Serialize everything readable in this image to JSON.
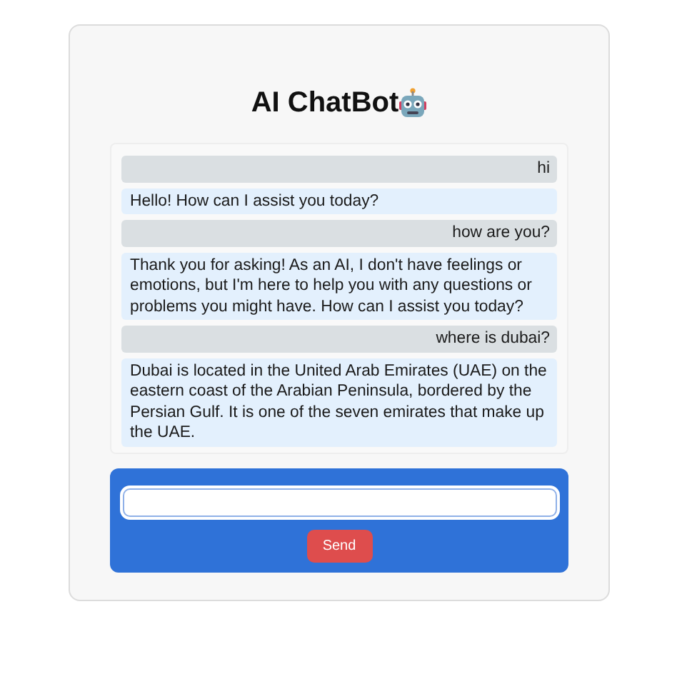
{
  "title": "AI ChatBot",
  "messages": [
    {
      "kind": "user",
      "text": "hi"
    },
    {
      "kind": "bot",
      "text": "Hello! How can I assist you today?"
    },
    {
      "kind": "user",
      "text": "how are you?"
    },
    {
      "kind": "bot",
      "text": "Thank you for asking! As an AI, I don't have feelings or emotions, but I'm here to help you with any questions or problems you might have. How can I assist you today?"
    },
    {
      "kind": "user",
      "text": "where is dubai?"
    },
    {
      "kind": "bot",
      "text": "Dubai is located in the United Arab Emirates (UAE) on the eastern coast of the Arabian Peninsula, bordered by the Persian Gulf. It is one of the seven emirates that make up the UAE."
    }
  ],
  "send_button": "Send"
}
